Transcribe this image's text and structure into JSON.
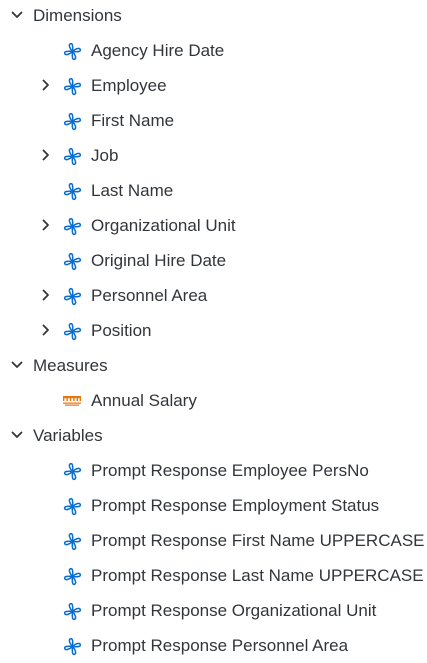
{
  "colors": {
    "text": "#32363a",
    "caret": "#32363a",
    "dimension_icon": "#0a6ed1",
    "measure_icon": "#e9730c"
  },
  "sections": [
    {
      "label": "Dimensions",
      "expanded": true,
      "items": [
        {
          "label": "Agency Hire Date",
          "icon": "dimension-icon",
          "expandable": false
        },
        {
          "label": "Employee",
          "icon": "dimension-icon",
          "expandable": true
        },
        {
          "label": "First Name",
          "icon": "dimension-icon",
          "expandable": false
        },
        {
          "label": "Job",
          "icon": "dimension-icon",
          "expandable": true
        },
        {
          "label": "Last Name",
          "icon": "dimension-icon",
          "expandable": false
        },
        {
          "label": "Organizational Unit",
          "icon": "dimension-icon",
          "expandable": true
        },
        {
          "label": "Original Hire Date",
          "icon": "dimension-icon",
          "expandable": false
        },
        {
          "label": "Personnel Area",
          "icon": "dimension-icon",
          "expandable": true
        },
        {
          "label": "Position",
          "icon": "dimension-icon",
          "expandable": true
        }
      ]
    },
    {
      "label": "Measures",
      "expanded": true,
      "items": [
        {
          "label": "Annual Salary",
          "icon": "measure-icon",
          "expandable": false
        }
      ]
    },
    {
      "label": "Variables",
      "expanded": true,
      "items": [
        {
          "label": "Prompt Response Employee PersNo",
          "icon": "dimension-icon",
          "expandable": false
        },
        {
          "label": "Prompt Response Employment Status",
          "icon": "dimension-icon",
          "expandable": false
        },
        {
          "label": "Prompt Response First Name UPPERCASE",
          "icon": "dimension-icon",
          "expandable": false
        },
        {
          "label": "Prompt Response Last Name UPPERCASE",
          "icon": "dimension-icon",
          "expandable": false
        },
        {
          "label": "Prompt Response Organizational Unit",
          "icon": "dimension-icon",
          "expandable": false
        },
        {
          "label": "Prompt Response Personnel Area",
          "icon": "dimension-icon",
          "expandable": false
        }
      ]
    }
  ]
}
